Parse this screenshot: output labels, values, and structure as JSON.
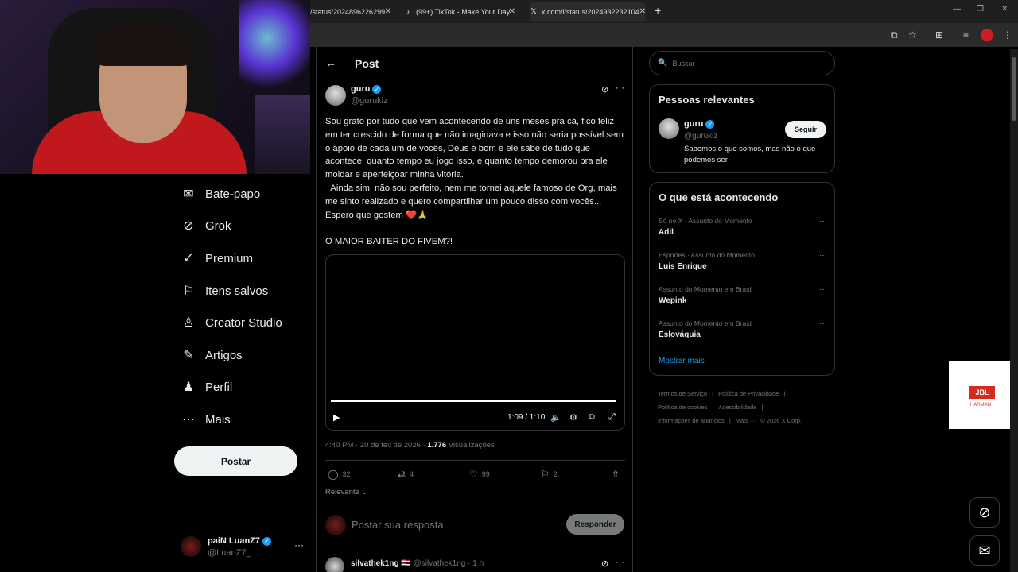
{
  "browser": {
    "tabs": [
      {
        "title": "/status/2024896226299",
        "icon": "x-icon"
      },
      {
        "title": "(99+) TikTok - Make Your Day",
        "icon": "tiktok-icon"
      },
      {
        "title": "x.com/i/status/2024932232104",
        "icon": "x-icon"
      }
    ],
    "new_tab": "+",
    "window_controls": [
      "—",
      "❐",
      "✕"
    ]
  },
  "nav": {
    "items": [
      {
        "label": "Bate-papo",
        "icon": "mail-icon",
        "glyph": "✉"
      },
      {
        "label": "Grok",
        "icon": "grok-icon",
        "glyph": "⊘"
      },
      {
        "label": "Premium",
        "icon": "premium-icon",
        "glyph": "✓"
      },
      {
        "label": "Itens salvos",
        "icon": "bookmark-icon",
        "glyph": "⚐"
      },
      {
        "label": "Creator Studio",
        "icon": "creator-icon",
        "glyph": "♙"
      },
      {
        "label": "Artigos",
        "icon": "articles-icon",
        "glyph": "✎"
      },
      {
        "label": "Perfil",
        "icon": "profile-icon",
        "glyph": "♟"
      },
      {
        "label": "Mais",
        "icon": "more-icon",
        "glyph": "⋯"
      }
    ],
    "post_button": "Postar",
    "account": {
      "name": "paiN LuanZ7",
      "handle": "@LuanZ7_"
    }
  },
  "post": {
    "header": "Post",
    "author": {
      "name": "guru",
      "handle": "@gurukiz"
    },
    "text": "Sou grato por tudo que vem acontecendo de uns meses pra cá, fico feliz em ter crescido de forma que não imaginava e isso não seria possível sem o apoio de cada um de vocês, Deus é bom e ele sabe de tudo que acontece, quanto tempo eu jogo isso, e quanto tempo demorou pra ele moldar e aperfeiçoar minha vitória.\n  Ainda sim, não sou perfeito, nem me tornei aquele famoso de Org, mais me sinto realizado e quero compartilhar um pouco disso com vocês... Espero que gostem ❤️🙏\n\nO MAIOR BAITER DO FIVEM?!",
    "video": {
      "time": "1:09 / 1:10",
      "progress": 0.985
    },
    "meta_time": "4:40 PM · 20 de fev de 2026 · ",
    "views_count": "1.776",
    "views_label": " Visualizações",
    "actions": {
      "replies": "32",
      "reposts": "4",
      "likes": "99",
      "bookmarks": "2"
    },
    "sort": "Relevante",
    "reply_placeholder": "Postar sua resposta",
    "reply_button": "Responder"
  },
  "reply": {
    "name": "silvathek1ng",
    "flag": "🇹🇭",
    "handle": "@silvathek1ng",
    "time": "· 1 h"
  },
  "sidebar": {
    "search_placeholder": "Buscar",
    "people_title": "Pessoas relevantes",
    "person": {
      "name": "guru",
      "handle": "@gurukiz",
      "bio": "Sabemos o que somos, mas não o que podemos ser",
      "follow": "Seguir"
    },
    "trends_title": "O que está acontecendo",
    "trends": [
      {
        "category": "Só no X · Assunto do Momento",
        "name": "Adil"
      },
      {
        "category": "Esportes · Assunto do Momento",
        "name": "Luis Enrique"
      },
      {
        "category": "Assunto do Momento em Brasil",
        "name": "Wepink"
      },
      {
        "category": "Assunto do Momento em Brasil",
        "name": "Eslováquia"
      }
    ],
    "show_more": "Mostrar mais",
    "footer": [
      "Termos de Serviço",
      "|",
      "Política de Privacidade",
      "|",
      "Política de cookies",
      "|",
      "Acessibilidade",
      "|",
      "Informações de anúncios",
      "|",
      "Mais ···",
      "© 2026 X Corp."
    ]
  },
  "ad": {
    "brand": "JBL",
    "sub": "HARMAN"
  }
}
